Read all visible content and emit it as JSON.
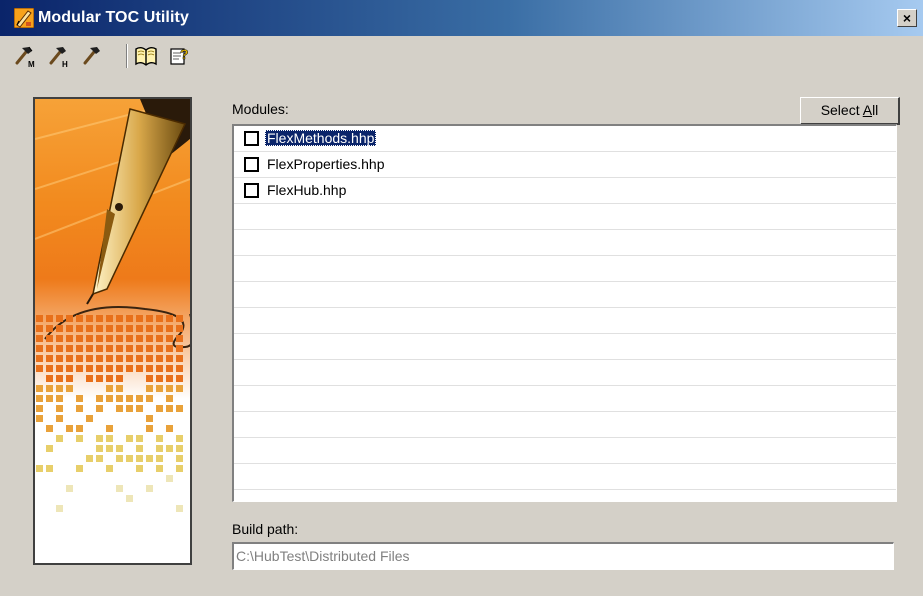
{
  "window": {
    "title": "Modular TOC Utility",
    "close_label": "×"
  },
  "toolbar": {
    "buttons": [
      {
        "name": "build-m-icon",
        "sub": "M"
      },
      {
        "name": "build-h-icon",
        "sub": "H"
      },
      {
        "name": "build-icon",
        "sub": ""
      },
      {
        "name": "book-icon",
        "sub": ""
      },
      {
        "name": "help-icon",
        "sub": ""
      }
    ]
  },
  "modules": {
    "label": "Modules:",
    "select_all_prefix": "Select ",
    "select_all_hotkey": "A",
    "select_all_suffix": "ll",
    "items": [
      {
        "label": "FlexMethods.hhp",
        "checked": false,
        "selected": true
      },
      {
        "label": "FlexProperties.hhp",
        "checked": false,
        "selected": false
      },
      {
        "label": "FlexHub.hhp",
        "checked": false,
        "selected": false
      }
    ]
  },
  "build": {
    "label": "Build path:",
    "value": "C:\\HubTest\\Distributed Files"
  },
  "colors": {
    "titlebar_start": "#0a246a",
    "titlebar_end": "#a6caf0",
    "face": "#d4d0c8",
    "selection": "#0a246a",
    "art_orange": "#f28a1e"
  }
}
